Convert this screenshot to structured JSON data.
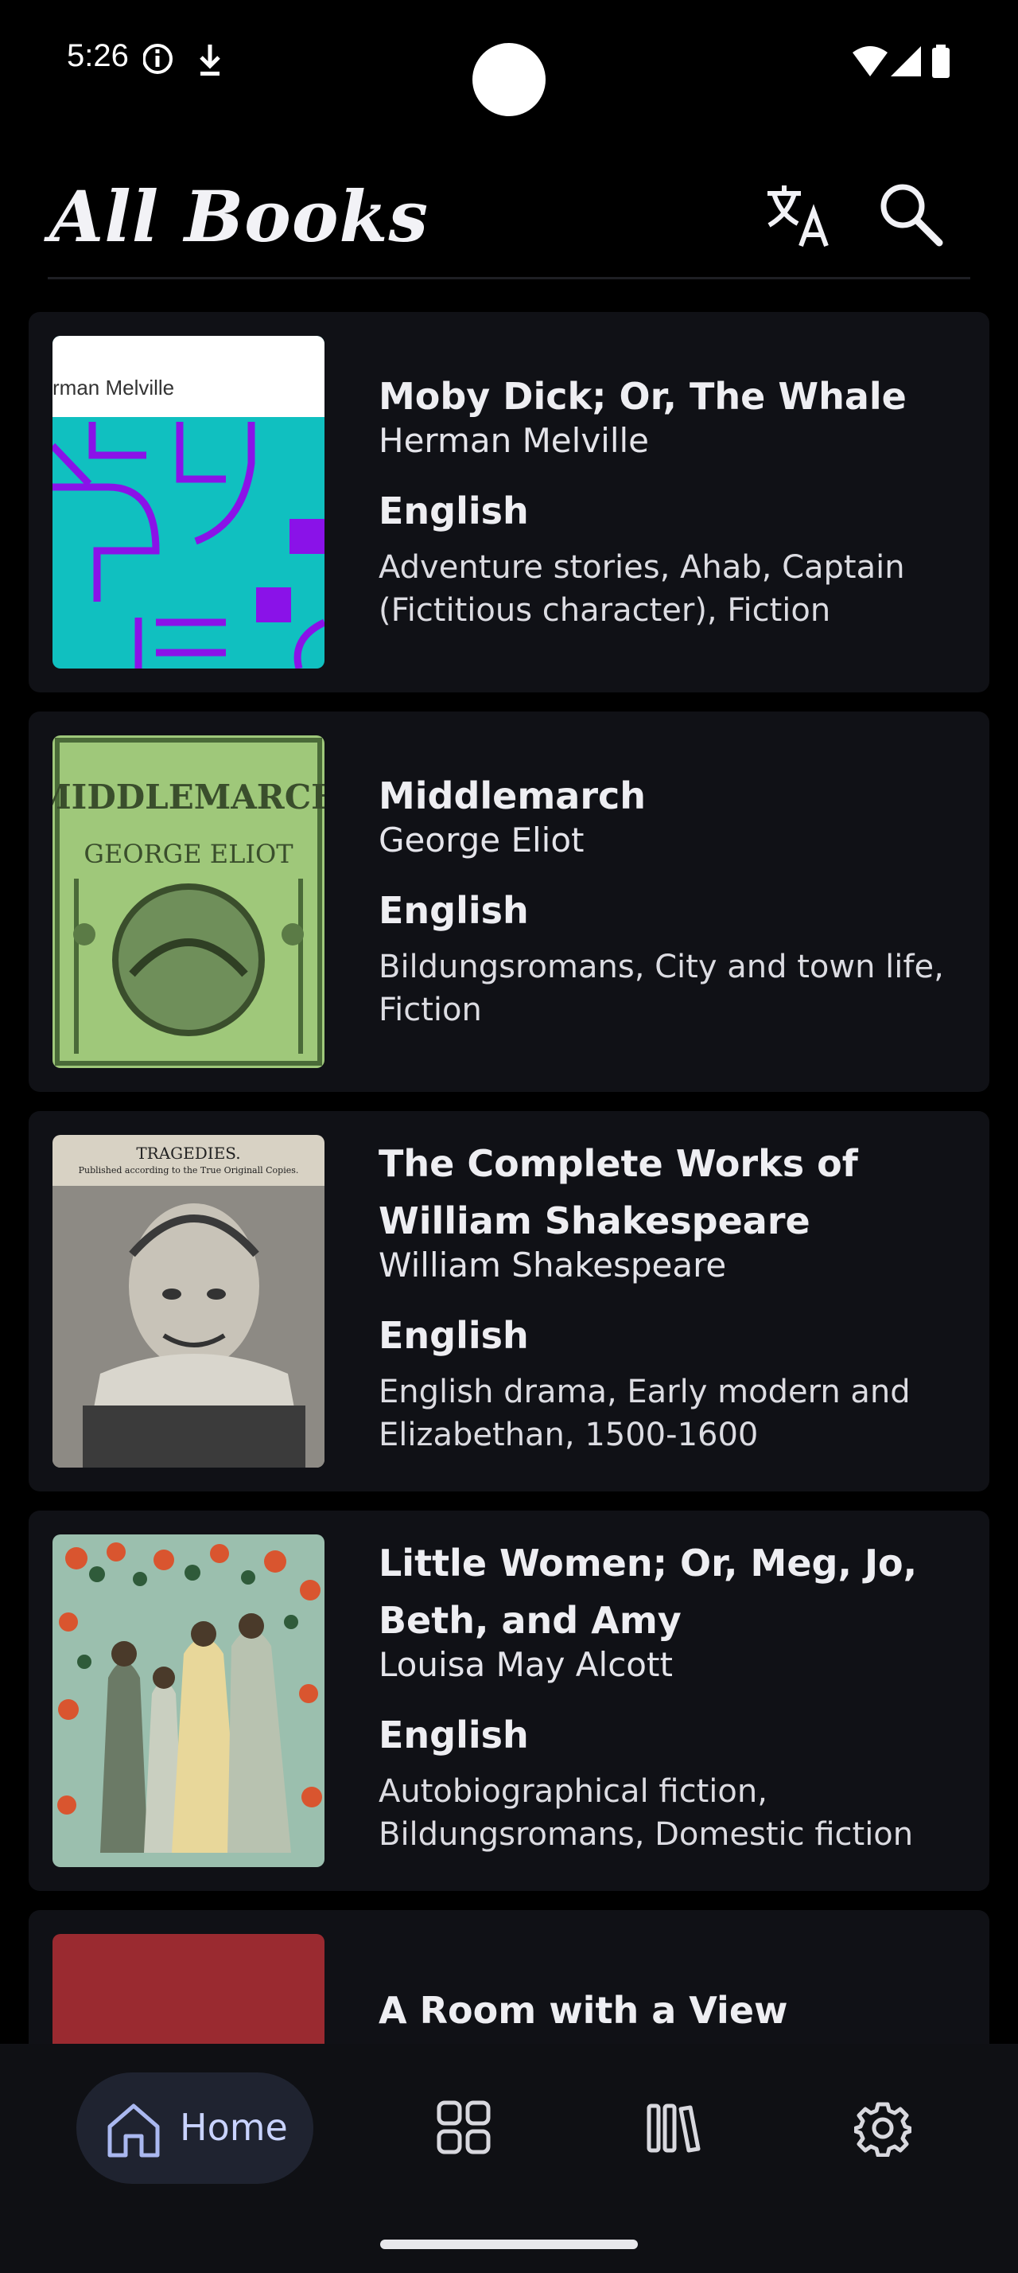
{
  "status_bar": {
    "time": "5:26",
    "left_icons": [
      "info-icon",
      "download-icon"
    ],
    "right_icons": [
      "wifi-icon",
      "signal-icon",
      "battery-icon"
    ]
  },
  "header": {
    "title": "All Books",
    "actions": [
      "translate-icon",
      "search-icon"
    ]
  },
  "books": [
    {
      "title": "Moby Dick; Or, The Whale",
      "author": "Herman Melville",
      "language": "English",
      "subjects": "Adventure stories, Ahab, Captain (Fictitious character), Fiction",
      "cover_text": "rman Melville"
    },
    {
      "title": "Middlemarch",
      "author": "George Eliot",
      "language": "English",
      "subjects": "Bildungsromans, City and town life, Fiction",
      "cover_text": "MIDDLEMARCH",
      "cover_text_2": "GEORGE ELIOT"
    },
    {
      "title": "The Complete Works of William Shakespeare",
      "author": "William Shakespeare",
      "language": "English",
      "subjects": "English drama, Early modern and Elizabethan, 1500-1600",
      "cover_text": "TRAGEDIES.",
      "cover_text_2": "Published according to the True Originall Copies."
    },
    {
      "title": "Little Women; Or, Meg, Jo, Beth, and Amy",
      "author": "Louisa May Alcott",
      "language": "English",
      "subjects": "Autobiographical fiction, Bildungsromans, Domestic fiction"
    },
    {
      "title": "A Room with a View"
    }
  ],
  "bottom_nav": {
    "items": [
      {
        "label": "Home",
        "icon": "home-icon",
        "selected": true
      },
      {
        "icon": "grid-icon"
      },
      {
        "icon": "library-icon"
      },
      {
        "icon": "gear-icon"
      }
    ]
  },
  "colors": {
    "background": "#000000",
    "card": "#101116",
    "nav_selected": "#1f2330",
    "nav_selected_text": "#c9d3ff"
  }
}
